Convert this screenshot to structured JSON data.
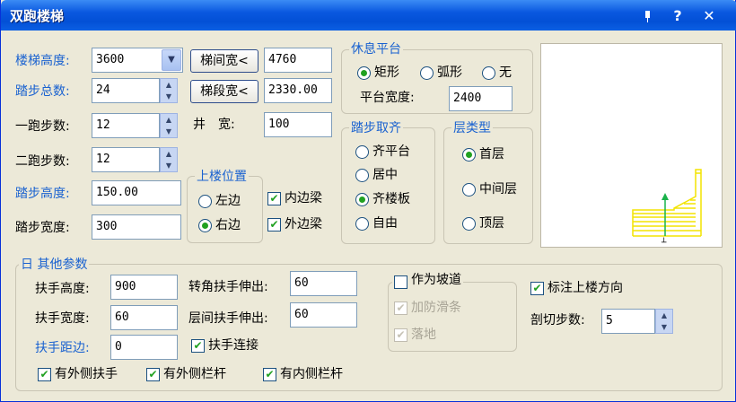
{
  "window": {
    "title": "双跑楼梯",
    "pin_icon": "pin-icon",
    "help_label": "?",
    "close_label": "✕"
  },
  "params": {
    "stair_height": {
      "label": "楼梯高度:",
      "value": "3600"
    },
    "step_total": {
      "label": "踏步总数:",
      "value": "24"
    },
    "flight1_steps": {
      "label": "一跑步数:",
      "value": "12"
    },
    "flight2_steps": {
      "label": "二跑步数:",
      "value": "12"
    },
    "step_height": {
      "label": "踏步高度:",
      "value": "150.00"
    },
    "step_width": {
      "label": "踏步宽度:",
      "value": "300"
    },
    "stairwell_width": {
      "button": "梯间宽<",
      "value": "4760"
    },
    "flight_width": {
      "button": "梯段宽<",
      "value": "2330.00"
    },
    "well": {
      "label": "井　宽:",
      "value": "100"
    }
  },
  "landing": {
    "title": "休息平台",
    "options": [
      "矩形",
      "弧形",
      "无"
    ],
    "selected": "矩形",
    "width_label": "平台宽度:",
    "width_value": "2400"
  },
  "upstairs": {
    "title": "上楼位置",
    "options": [
      "左边",
      "右边"
    ],
    "selected": "右边"
  },
  "beams": {
    "inner": "内边梁",
    "outer": "外边梁",
    "inner_checked": true,
    "outer_checked": true
  },
  "step_align": {
    "title": "踏步取齐",
    "options": [
      "齐平台",
      "居中",
      "齐楼板",
      "自由"
    ],
    "selected": "齐楼板"
  },
  "floor_type": {
    "title": "层类型",
    "options": [
      "首层",
      "中间层",
      "顶层"
    ],
    "selected": "首层"
  },
  "other": {
    "title": "日 其他参数",
    "handrail_height": {
      "label": "扶手高度:",
      "value": "900"
    },
    "handrail_width": {
      "label": "扶手宽度:",
      "value": "60"
    },
    "handrail_offset": {
      "label": "扶手距边:",
      "value": "0"
    },
    "corner_ext": {
      "label": "转角扶手伸出:",
      "value": "60"
    },
    "floor_ext": {
      "label": "层间扶手伸出:",
      "value": "60"
    },
    "handrail_connect": {
      "label": "扶手连接",
      "checked": true
    },
    "ramp": {
      "label": "作为坡道",
      "checked": false
    },
    "anti_slip": {
      "label": "加防滑条",
      "checked": true
    },
    "landing_ground": {
      "label": "落地",
      "checked": true
    },
    "mark_up": {
      "label": "标注上楼方向",
      "checked": true
    },
    "cut_steps": {
      "label": "剖切步数:",
      "value": "5"
    },
    "outer_handrail": {
      "label": "有外侧扶手",
      "checked": true
    },
    "outer_railing": {
      "label": "有外侧栏杆",
      "checked": true
    },
    "inner_railing": {
      "label": "有内侧栏杆",
      "checked": true
    }
  },
  "colors": {
    "accent": "#1a62d0",
    "check": "#21a121",
    "preview_stair": "#f3e400",
    "preview_arrow": "#19b24a"
  }
}
